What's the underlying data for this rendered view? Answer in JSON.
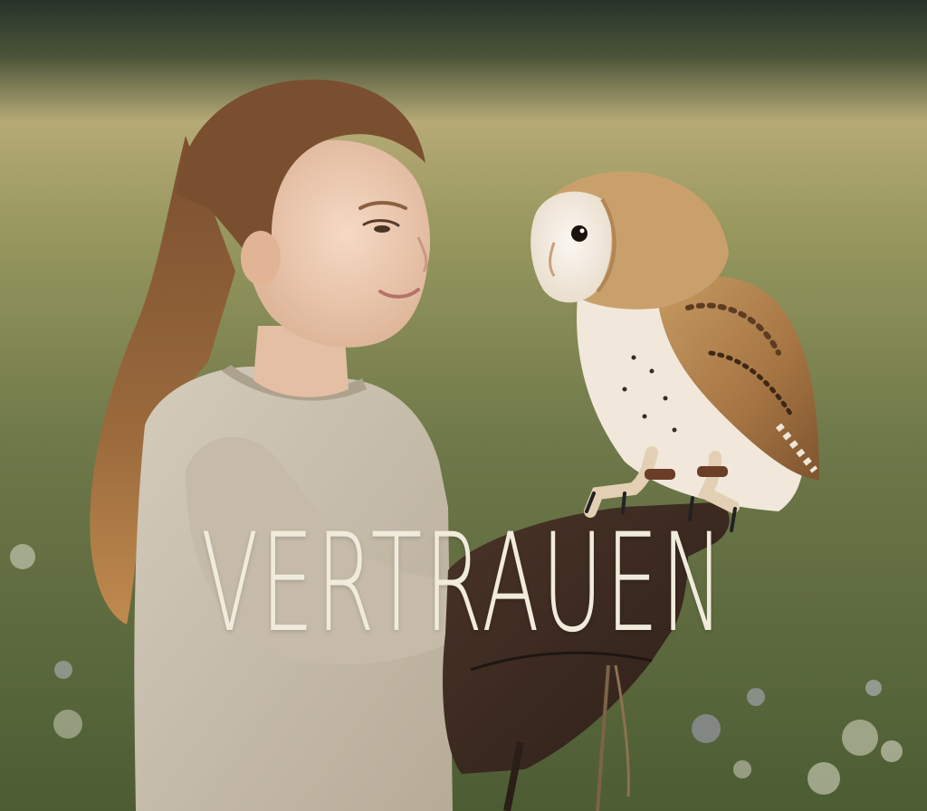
{
  "overlay": {
    "headline": "VERTRAUEN"
  },
  "scene": {
    "subjects": [
      "girl-with-ponytail",
      "barn-owl",
      "leather-falconry-glove"
    ],
    "colors": {
      "meadow_light": "#b9ad78",
      "meadow_dark": "#5d6b3e",
      "sky_dark": "#2a352c",
      "sweater": "#c9bfae",
      "hair": "#8a5a34",
      "owl_face": "#f5efe6",
      "owl_wing": "#b98a52",
      "glove": "#3f2c22",
      "headline": "#f1ebdc"
    }
  }
}
